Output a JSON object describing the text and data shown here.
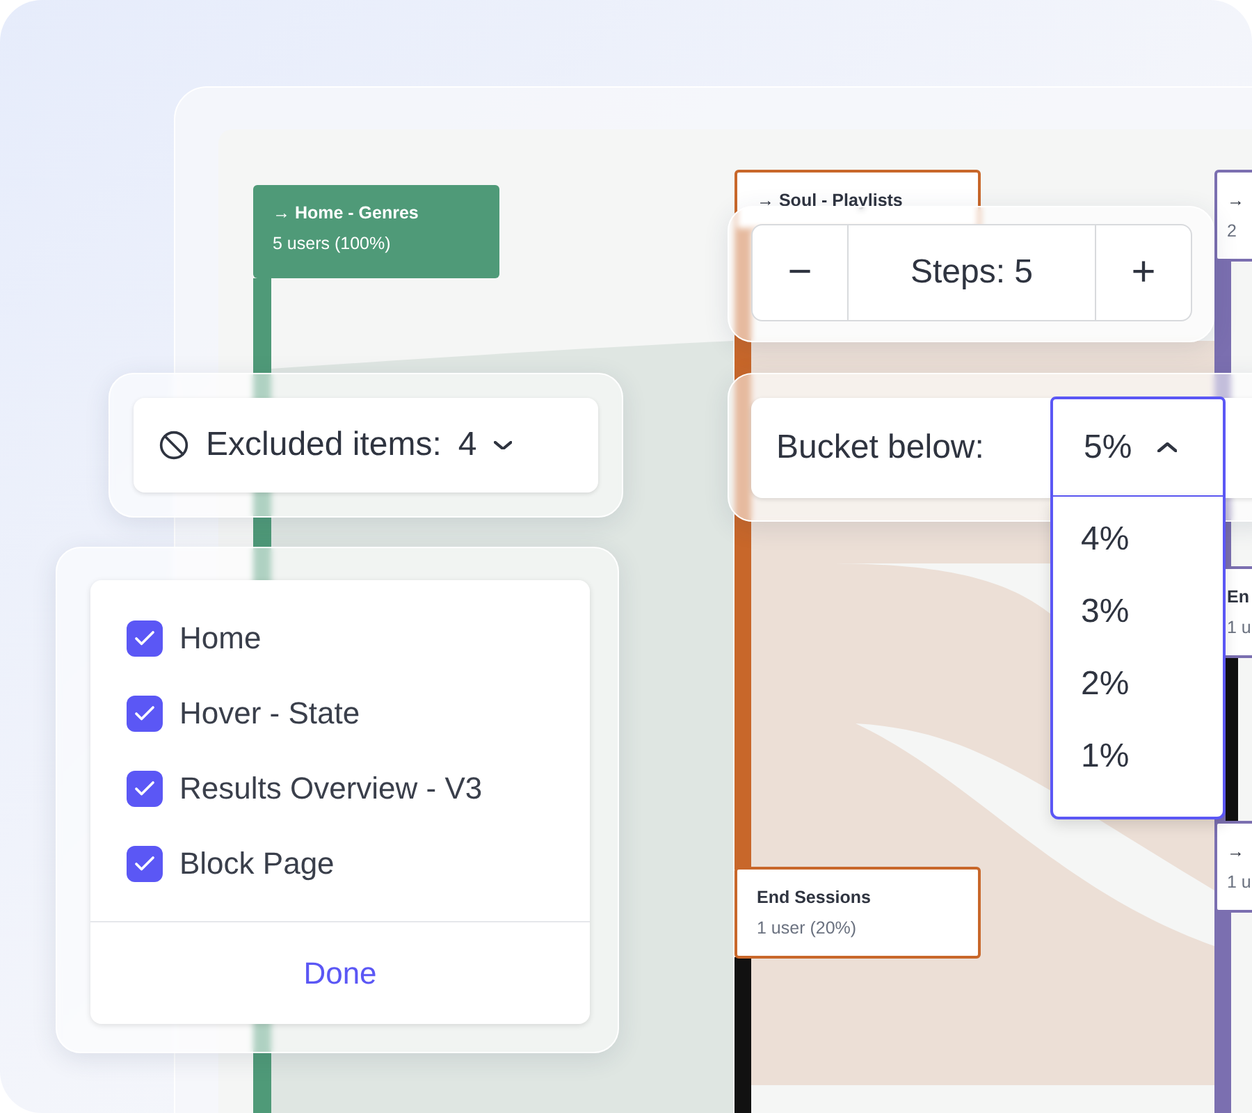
{
  "diagram": {
    "nodes": [
      {
        "title": "→ Home - Genres",
        "subtitle": "5 users (100%)",
        "color": "#4f9a78",
        "kind": "filled"
      },
      {
        "title": "→ Soul - Playlists",
        "color": "#c8672a",
        "kind": "outlined"
      },
      {
        "title": "End Sessions",
        "subtitle": "1 user (20%)",
        "color": "#c8672a",
        "kind": "outlined"
      },
      {
        "title": "→",
        "subtitle": "2",
        "color": "#7b6fb0",
        "kind": "outlined"
      },
      {
        "title": "En",
        "subtitle": "1 u",
        "color": "#7b6fb0",
        "kind": "outlined"
      },
      {
        "title": "→",
        "subtitle": "1 u",
        "color": "#7b6fb0",
        "kind": "outlined"
      }
    ]
  },
  "steps": {
    "decrease": "−",
    "label": "Steps: 5",
    "increase": "+"
  },
  "excluded": {
    "label": "Excluded items:",
    "count": "4",
    "expanded": false,
    "items": [
      {
        "label": "Home",
        "checked": true
      },
      {
        "label": "Hover - State",
        "checked": true
      },
      {
        "label": "Results Overview - V3",
        "checked": true
      },
      {
        "label": "Block Page",
        "checked": true
      }
    ],
    "done": "Done"
  },
  "bucket": {
    "label": "Bucket below:",
    "value": "5%",
    "expanded": true,
    "options": [
      {
        "label": "4%",
        "selected": false
      },
      {
        "label": "3%",
        "selected": false
      },
      {
        "label": "2%",
        "selected": false
      },
      {
        "label": "1%",
        "selected": false
      }
    ]
  }
}
